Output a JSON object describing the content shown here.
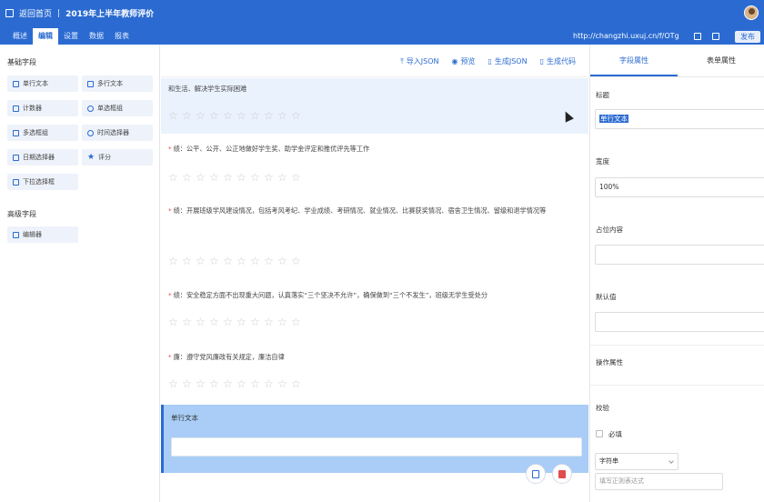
{
  "header": {
    "back_label": "返回首页",
    "separator": "|",
    "title": "2019年上半年教师评价"
  },
  "tabs": [
    {
      "label": "概述"
    },
    {
      "label": "编辑"
    },
    {
      "label": "设置"
    },
    {
      "label": "数据"
    },
    {
      "label": "报表"
    }
  ],
  "url": "http://changzhi.uxuj.cn/f/OTg",
  "publish_label": "发布",
  "left": {
    "basic_title": "基础字段",
    "basic_items": [
      {
        "label": "单行文本",
        "icon": "text-line-icon"
      },
      {
        "label": "多行文本",
        "icon": "text-area-icon"
      },
      {
        "label": "计数器",
        "icon": "counter-icon"
      },
      {
        "label": "单选框组",
        "icon": "radio-icon"
      },
      {
        "label": "多选框组",
        "icon": "checkbox-icon"
      },
      {
        "label": "时间选择器",
        "icon": "clock-icon"
      },
      {
        "label": "日期选择器",
        "icon": "calendar-icon"
      },
      {
        "label": "评分",
        "icon": "star-icon"
      },
      {
        "label": "下拉选择框",
        "icon": "dropdown-icon"
      }
    ],
    "advanced_title": "高级字段",
    "advanced_items": [
      {
        "label": "编辑器",
        "icon": "editor-icon"
      }
    ]
  },
  "toolbar": {
    "import_json": "导入JSON",
    "preview": "预览",
    "gen_json": "生成JSON",
    "gen_code": "生成代码"
  },
  "questions": [
    {
      "text": "和生活、解决学生实际困难",
      "required": false
    },
    {
      "text": "绩：公平、公开、公正地做好学生奖、助学金评定和推优评先等工作",
      "required": true
    },
    {
      "text": "绩：开展班级学风建设情况，包括考风考纪、学业成绩、考研情况、就业情况、比赛获奖情况、宿舍卫生情况、留级和退学情况等",
      "required": true
    },
    {
      "text": "绩：安全稳定方面不出现重大问题，认真落实“三个坚决不允许”，确保做到“三个不发生”，班级无学生受处分",
      "required": true
    },
    {
      "text": "廉：遵守党风廉政有关规定，廉洁自律",
      "required": true
    }
  ],
  "selected_field": {
    "label": "单行文本"
  },
  "right": {
    "tab_field": "字段属性",
    "tab_form": "表单属性",
    "title_label": "标题",
    "title_value": "单行文本",
    "width_label": "宽度",
    "width_value": "100%",
    "placeholder_label": "占位内容",
    "default_label": "默认值",
    "ops_label": "操作属性",
    "validate_label": "校验",
    "required_label": "必填",
    "type_select": "字符串",
    "regex_placeholder": "填写正则表达式"
  },
  "colors": {
    "primary": "#2b6bd1",
    "selected_bg": "#a9cdf6",
    "danger": "#e24c4c"
  }
}
